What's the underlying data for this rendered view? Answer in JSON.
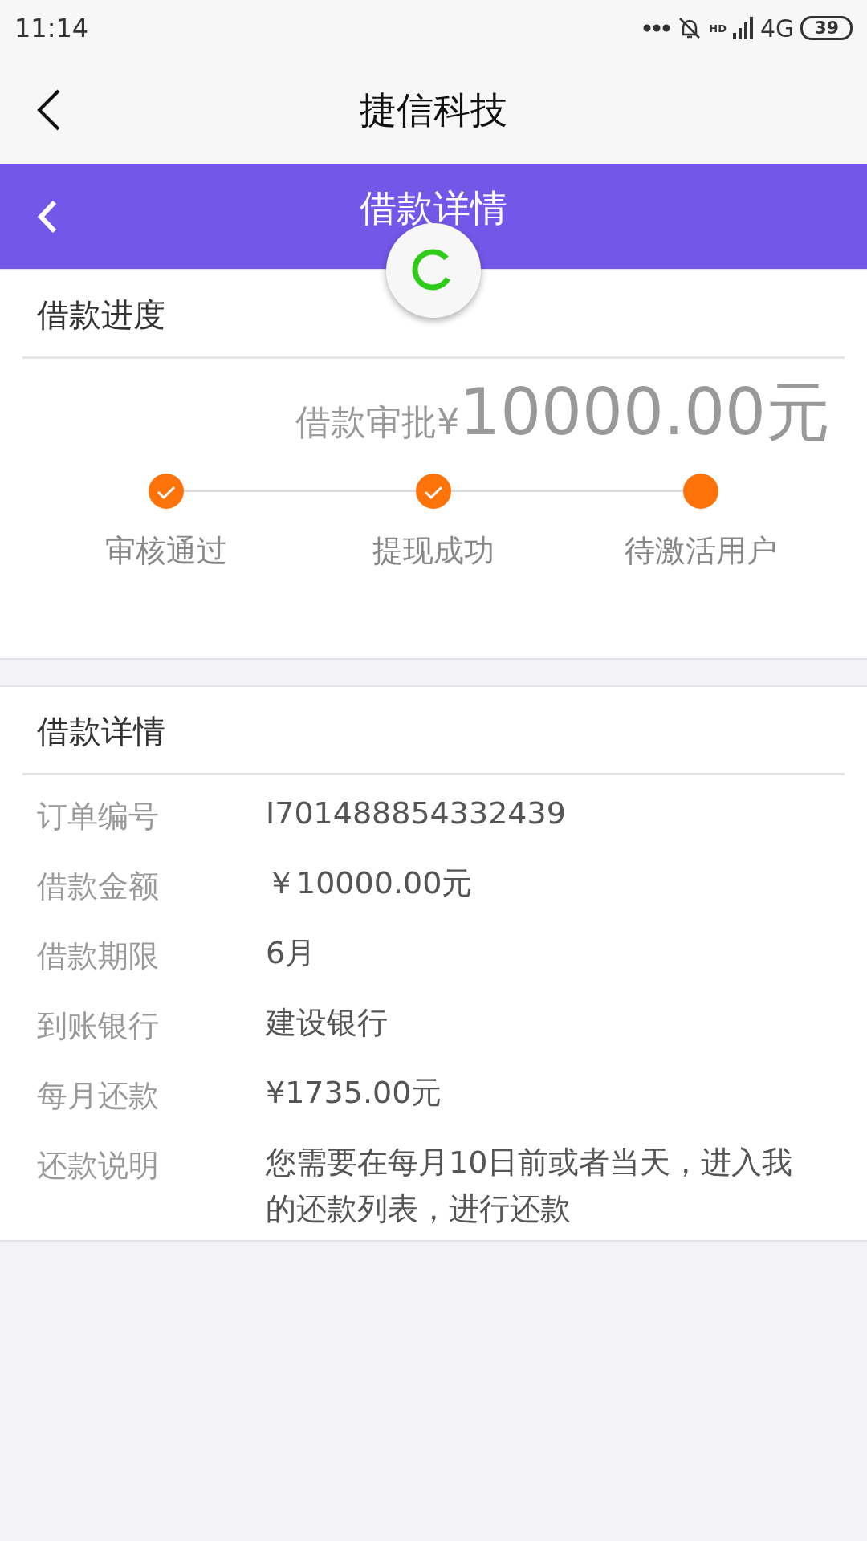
{
  "status_bar": {
    "time": "11:14",
    "network_badge": "HD",
    "network": "4G",
    "battery": "39"
  },
  "app_bar": {
    "title": "捷信科技"
  },
  "page_header": {
    "title": "借款详情"
  },
  "loading": true,
  "progress": {
    "title": "借款进度",
    "amount_label": "借款审批¥",
    "amount": "10000.00",
    "unit": "元",
    "steps": [
      {
        "label": "审核通过",
        "completed": true
      },
      {
        "label": "提现成功",
        "completed": true
      },
      {
        "label": "待激活用户",
        "completed": false
      }
    ]
  },
  "details": {
    "title": "借款详情",
    "rows": [
      {
        "label": "订单编号",
        "value": "I701488854332439"
      },
      {
        "label": "借款金额",
        "value": " ￥10000.00元"
      },
      {
        "label": "借款期限",
        "value": "6月"
      },
      {
        "label": "到账银行",
        "value": "建设银行"
      },
      {
        "label": "每月还款",
        "value": "¥1735.00元"
      },
      {
        "label": "还款说明",
        "value": "您需要在每月10日前或者当天，进入我的还款列表，进行还款"
      }
    ]
  }
}
